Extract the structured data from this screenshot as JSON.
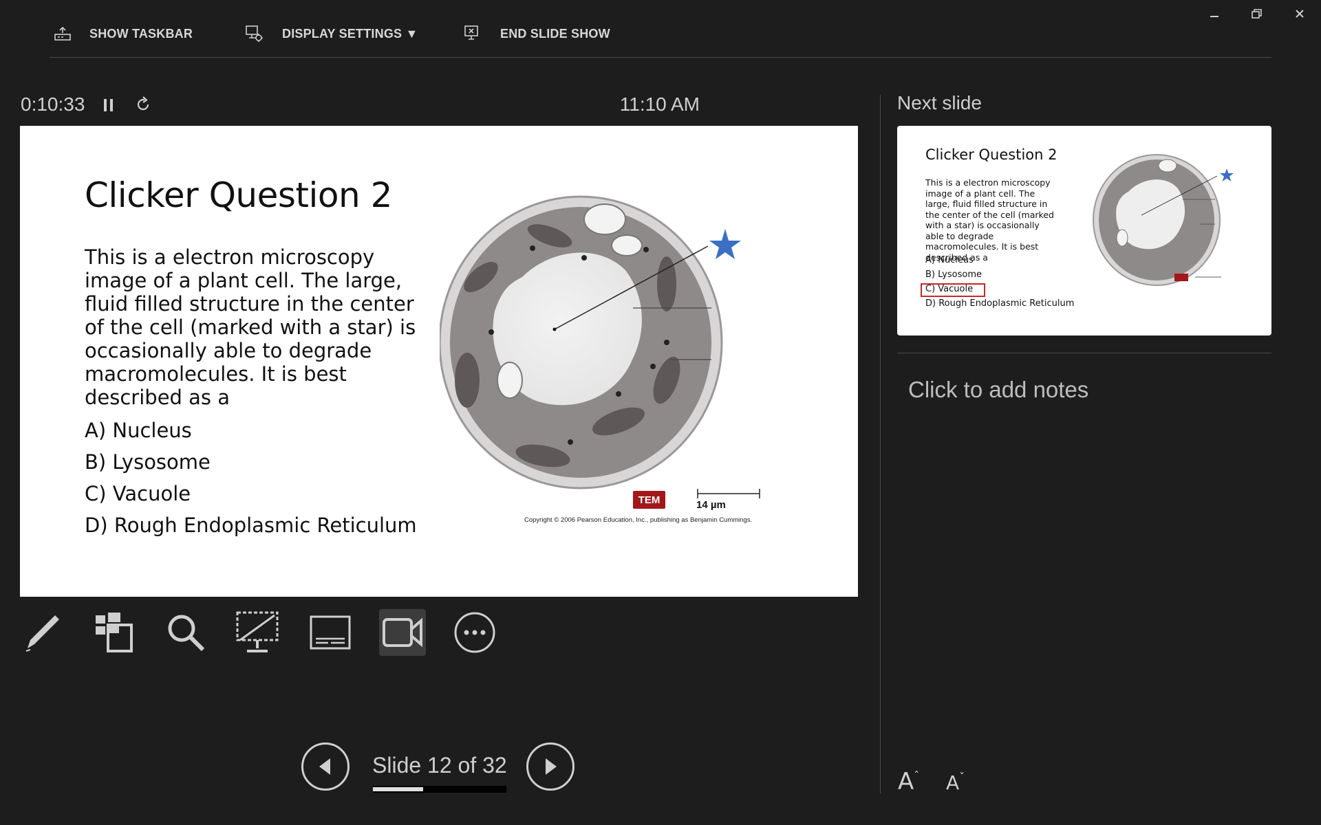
{
  "toolbar": {
    "show_taskbar": "SHOW TASKBAR",
    "display_settings": "DISPLAY SETTINGS ▼",
    "end_slide_show": "END SLIDE SHOW"
  },
  "timer": {
    "elapsed": "0:10:33",
    "clock": "11:10 AM"
  },
  "slide": {
    "title": "Clicker Question 2",
    "body": "This is a electron microscopy image of a plant cell. The large, fluid filled structure in the center of the cell (marked with a star) is occasionally able to degrade macromolecules. It is best described as a",
    "options": [
      "A) Nucleus",
      "B) Lysosome",
      "C) Vacuole",
      "D) Rough Endoplasmic Reticulum"
    ],
    "badge": "TEM",
    "scale": "14 µm",
    "copyright": "Copyright © 2006 Pearson Education, Inc., publishing as Benjamin Cummings."
  },
  "navigation": {
    "counter": "Slide 12 of 32",
    "current": 12,
    "total": 32
  },
  "next_slide": {
    "label": "Next slide",
    "title": "Clicker Question 2",
    "body": "This is a electron microscopy image of a plant cell. The large, fluid filled structure in the center of the cell (marked with a star) is occasionally able to degrade macromolecules. It is best described as a",
    "options": [
      "A) Nucleus",
      "B) Lysosome",
      "C) Vacuole",
      "D) Rough Endoplasmic Reticulum"
    ],
    "highlighted_option": "C) Vacuole"
  },
  "notes": {
    "placeholder": "Click to add notes"
  },
  "font_controls": {
    "increase": "A",
    "decrease": "A"
  },
  "colors": {
    "background": "#1d1d1d",
    "star": "#3a6fc4",
    "tem_badge": "#a3171a",
    "highlight_box": "#c62828"
  },
  "tools": [
    "pen-icon",
    "all-slides-icon",
    "zoom-icon",
    "black-screen-icon",
    "subtitles-icon",
    "camera-icon",
    "more-options-icon"
  ]
}
